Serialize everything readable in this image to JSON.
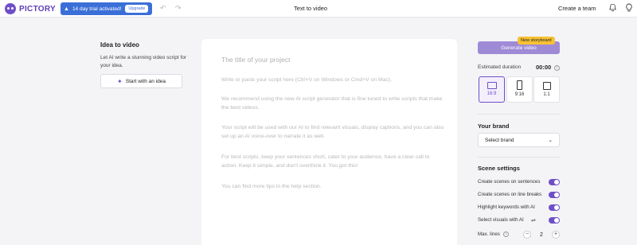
{
  "header": {
    "logo": "PICTORY",
    "trial_text": "14 day trial activated!",
    "upgrade_label": "Upgrade",
    "title": "Text to video",
    "create_team": "Create a team"
  },
  "left": {
    "title": "Idea to video",
    "description": "Let AI write a stunning video script for your idea.",
    "start_button": "Start with an idea"
  },
  "editor": {
    "title_placeholder": "The title of your project",
    "paragraphs": [
      "Write or paste your script here (Ctrl+V on Windows or Cmd+V on Mac).",
      "We recommend using the new AI script generator that is fine tuned to write scripts that make the best videos.",
      "Your script will be used with our AI to find relevant visuals, display captions, and you can also set up an AI voice-over to narrate it as well.",
      "For best scripts, keep your sentences short, cater to your audience, have a clear call to action. Keep it simple, and don't overthink it. You got this!",
      "You can find more tips in the help section."
    ]
  },
  "right": {
    "generate_button": "Generate video",
    "new_badge": "New storyboard",
    "estimated_duration_label": "Estimated duration",
    "estimated_duration_value": "00:00",
    "ratios": [
      {
        "label": "16:9",
        "active": true
      },
      {
        "label": "9:16",
        "active": false
      },
      {
        "label": "1:1",
        "active": false
      }
    ],
    "brand_title": "Your brand",
    "brand_select": "Select brand",
    "scene_title": "Scene settings",
    "settings": [
      {
        "label": "Create scenes on sentences",
        "on": true
      },
      {
        "label": "Create scenes on line breaks",
        "on": true
      },
      {
        "label": "Highlight keywords with AI",
        "on": true
      },
      {
        "label": "Select visuals with AI",
        "on": true
      }
    ],
    "max_lines_label": "Max. lines",
    "max_lines_value": "2"
  },
  "colors": {
    "accent": "#6e4fc7",
    "trial_bg": "#3b6fd8",
    "badge": "#f7c134"
  }
}
